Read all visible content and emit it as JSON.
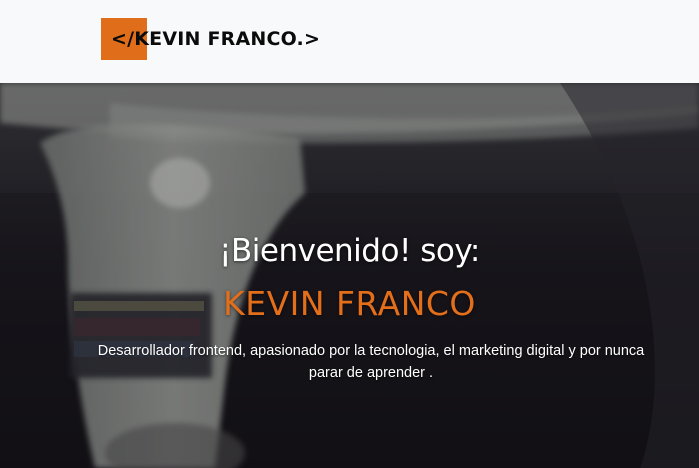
{
  "navbar": {
    "logo_text": "</KEVIN FRANCO.>",
    "logo_accent_color": "#e06d1a"
  },
  "hero": {
    "greeting": "¡Bienvenido! soy:",
    "name": "KEVIN FRANCO",
    "tagline": "Desarrollador frontend, apasionado por la tecnologia, el marketing digital y por nunca parar de aprender .",
    "name_color": "#e46f1b",
    "background_icon": "blurred-photo-background"
  }
}
